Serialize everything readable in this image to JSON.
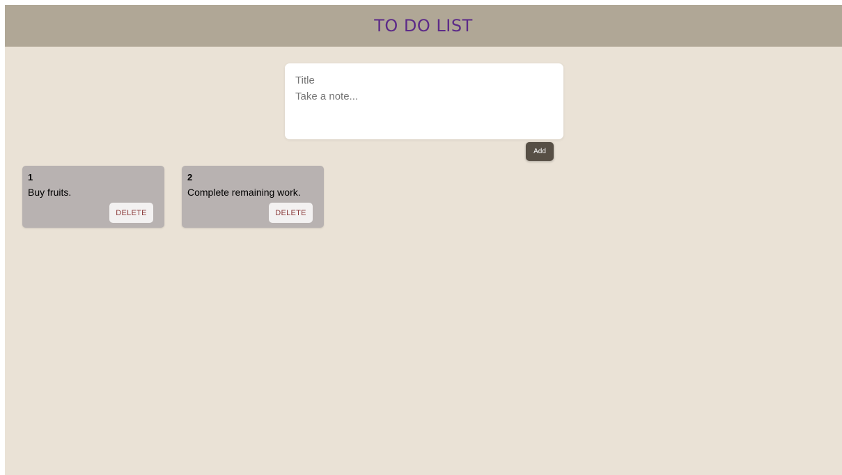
{
  "header": {
    "title": "TO DO LIST"
  },
  "composer": {
    "title_value": "",
    "title_placeholder": "Title",
    "content_value": "",
    "content_placeholder": "Take a note...",
    "add_label": "Add"
  },
  "notes": [
    {
      "title": "1",
      "content": "Buy fruits.",
      "delete_label": "DELETE"
    },
    {
      "title": "2",
      "content": "Complete remaining work.",
      "delete_label": "DELETE"
    }
  ],
  "colors": {
    "page_bg": "#eae2d6",
    "header_bg": "#b0a796",
    "header_text": "#5c2a88",
    "note_bg": "#b8b2b1",
    "add_button_bg": "#574f45",
    "delete_text": "#8b3a3a"
  }
}
